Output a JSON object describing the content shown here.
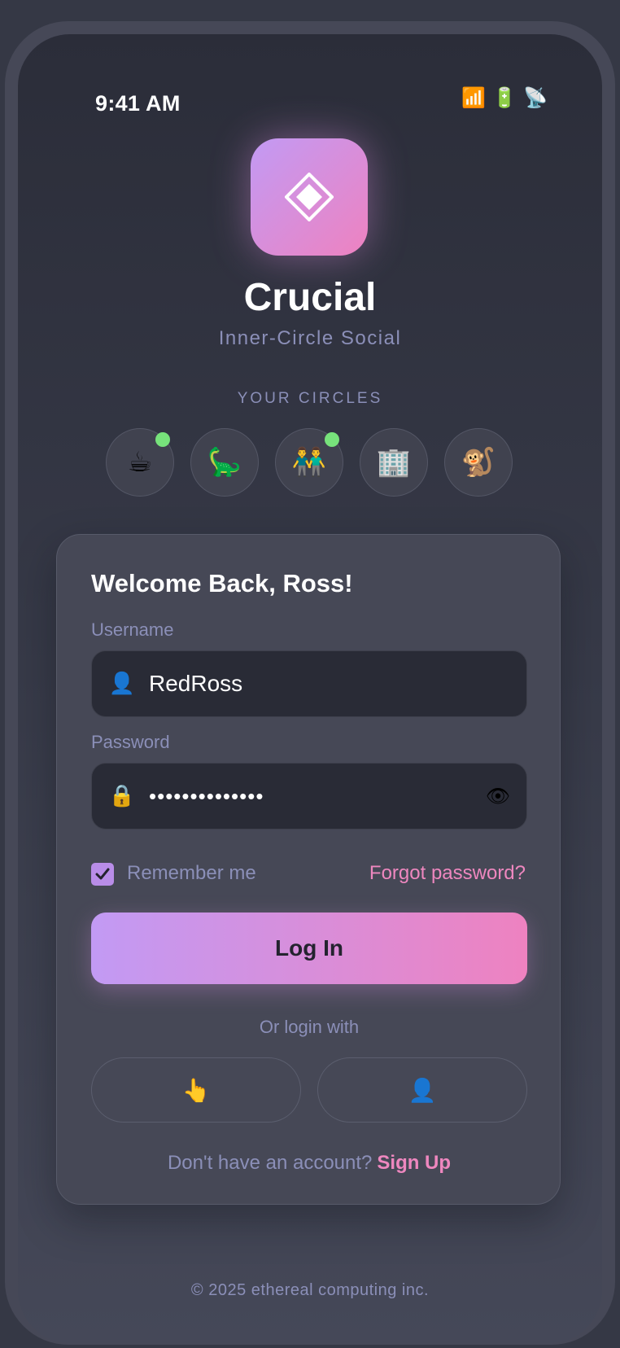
{
  "status_bar": {
    "time": "9:41 AM",
    "icons": [
      {
        "name": "signal-icon",
        "glyph": "📶"
      },
      {
        "name": "battery-icon",
        "glyph": "🔋"
      },
      {
        "name": "satellite-icon",
        "glyph": "📡"
      }
    ]
  },
  "app": {
    "logo_icon": "diamond-icon",
    "name": "Crucial",
    "tagline": "Inner-Circle Social"
  },
  "circles": {
    "heading": "YOUR CIRCLES",
    "items": [
      {
        "icon": "coffee-icon",
        "glyph": "☕",
        "online": true
      },
      {
        "icon": "dinosaur-icon",
        "glyph": "🦕",
        "online": false
      },
      {
        "icon": "people-icon",
        "glyph": "👬",
        "online": true
      },
      {
        "icon": "office-building-icon",
        "glyph": "🏢",
        "online": false
      },
      {
        "icon": "monkey-icon",
        "glyph": "🐒",
        "online": false
      }
    ]
  },
  "login": {
    "welcome": "Welcome Back, Ross!",
    "username_label": "Username",
    "username_value": "RedRoss",
    "username_icon": "👤",
    "password_label": "Password",
    "password_value": "••••••••••••••",
    "password_icon": "🔒",
    "show_password_icon": "👁",
    "remember_label": "Remember me",
    "remember_checked": true,
    "forgot_label": "Forgot password?",
    "login_button": "Log In",
    "alt_divider": "Or login with",
    "alt_buttons": [
      {
        "icon": "fingerprint-pointer-icon",
        "glyph": "👆"
      },
      {
        "icon": "face-id-user-icon",
        "glyph": "👤"
      }
    ],
    "signup_prompt": "Don't have an account?",
    "signup_link": "Sign Up"
  },
  "footer": "© 2025 ethereal computing inc.",
  "colors": {
    "accent_start": "#c29af4",
    "accent_end": "#ee82c0",
    "link": "#ee87bf",
    "muted_text": "#8b8fb8",
    "online_dot": "#77e27b"
  }
}
